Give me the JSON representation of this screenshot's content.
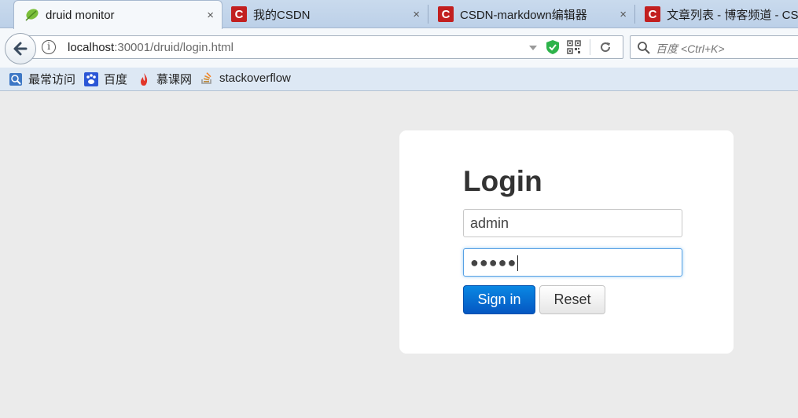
{
  "browser": {
    "tabs": [
      {
        "title": "druid monitor",
        "icon": "leaf-icon",
        "active": true
      },
      {
        "title": "我的CSDN",
        "icon": "csdn-icon",
        "active": false
      },
      {
        "title": "CSDN-markdown编辑器",
        "icon": "csdn-icon",
        "active": false
      },
      {
        "title": "文章列表 - 博客频道 - CSD",
        "icon": "csdn-icon",
        "active": false
      }
    ],
    "tab_close": "×",
    "url": {
      "host": "localhost",
      "rest": ":30001/druid/login.html"
    },
    "search_placeholder": "百度 <Ctrl+K>",
    "bookmarks": [
      {
        "label": "最常访问",
        "icon": "most-visited-icon"
      },
      {
        "label": "百度",
        "icon": "baidu-paw-icon"
      },
      {
        "label": "慕课网",
        "icon": "imooc-flame-icon"
      },
      {
        "label": "stackoverflow",
        "icon": "stackoverflow-icon"
      }
    ]
  },
  "login": {
    "title": "Login",
    "username": "admin",
    "password_mask": "●●●●●",
    "signin_label": "Sign in",
    "reset_label": "Reset"
  },
  "colors": {
    "page_bg": "#ebebeb",
    "signin_bg": "#0a6fd6",
    "tabstrip_bg": "#c9daed"
  }
}
